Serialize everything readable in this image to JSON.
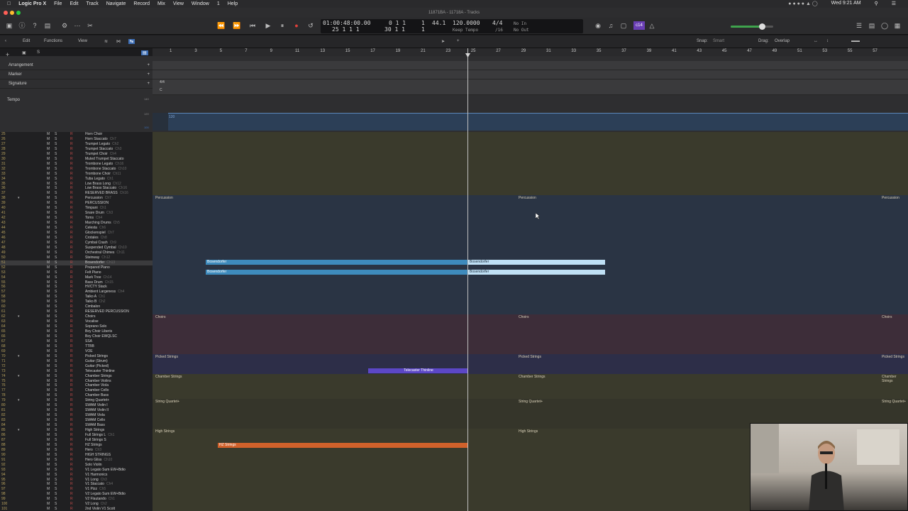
{
  "menubar": {
    "app": "Logic Pro X",
    "items": [
      "File",
      "Edit",
      "Track",
      "Navigate",
      "Record",
      "Mix",
      "View",
      "Window",
      "1",
      "Help"
    ],
    "clock": "Wed 9:21 AM"
  },
  "window": {
    "title": "11871BA - 11718A - Tracks"
  },
  "lcd": {
    "time": "01:00:48:00.00",
    "bars": "25  1  1    1",
    "end_a": "0  1  1",
    "end_b": "30  1  1",
    "end_a_sub": "1",
    "end_b_sub": "1",
    "sample": "44.1",
    "tempo": "120.0000",
    "tempo_label": "Keep Tempo",
    "sig": "4/4",
    "div": "/16",
    "in": "No In",
    "out": "No Out",
    "cpu": "c14"
  },
  "localbar": {
    "edit": "Edit",
    "functions": "Functions",
    "view": "View",
    "snap_label": "Snap:",
    "snap_value": "Smart",
    "drag_label": "Drag:",
    "drag_value": "Overlap"
  },
  "ruler": [
    "1",
    "3",
    "5",
    "7",
    "9",
    "11",
    "13",
    "15",
    "17",
    "19",
    "21",
    "23",
    "25",
    "27",
    "29",
    "31",
    "33",
    "35",
    "37",
    "39",
    "41",
    "43",
    "45",
    "47",
    "49",
    "51",
    "53",
    "55",
    "57"
  ],
  "global_tracks": {
    "arrangement": "Arrangement",
    "marker": "Marker",
    "signature": "Signature",
    "tempo": "Tempo",
    "sig_value": "4/4",
    "key_value": "C",
    "tempo_value": "120",
    "tempo_scale_hi": "140",
    "tempo_scale_mid": "120",
    "tempo_scale_lo": "100"
  },
  "tracks": [
    {
      "n": "25",
      "name": "Horn Choir",
      "ch": ""
    },
    {
      "n": "26",
      "name": "Horn Staccato",
      "ch": "Ch7"
    },
    {
      "n": "27",
      "name": "Trumpet Legato",
      "ch": "Ch2"
    },
    {
      "n": "28",
      "name": "Trumpet Staccato",
      "ch": "Ch3"
    },
    {
      "n": "29",
      "name": "Trumpet Choir",
      "ch": "Ch4"
    },
    {
      "n": "30",
      "name": "Muted Trumpet Staccato",
      "ch": ""
    },
    {
      "n": "31",
      "name": "Trombone Legato",
      "ch": "Ch16"
    },
    {
      "n": "32",
      "name": "Trombone Staccato",
      "ch": "Ch10"
    },
    {
      "n": "33",
      "name": "Trombone Choir",
      "ch": "Ch11"
    },
    {
      "n": "34",
      "name": "Tuba Legato",
      "ch": "Ch1"
    },
    {
      "n": "35",
      "name": "Low Brass Long",
      "ch": "Ch12"
    },
    {
      "n": "36",
      "name": "Low Brass Staccato",
      "ch": "Ch16"
    },
    {
      "n": "37",
      "name": "RESERVED BRASS",
      "ch": "Ch16"
    },
    {
      "n": "38",
      "name": "Percussion",
      "ch": "Ch7"
    },
    {
      "n": "39",
      "name": "PERCUSSION",
      "ch": ""
    },
    {
      "n": "40",
      "name": "Timpani",
      "ch": "Ch1"
    },
    {
      "n": "41",
      "name": "Snare Drum",
      "ch": "Ch3"
    },
    {
      "n": "42",
      "name": "Toms",
      "ch": "Ch4"
    },
    {
      "n": "43",
      "name": "Marching Drums",
      "ch": "Ch5"
    },
    {
      "n": "44",
      "name": "Celesta",
      "ch": "Ch6"
    },
    {
      "n": "45",
      "name": "Glockenspiel",
      "ch": "Ch7"
    },
    {
      "n": "46",
      "name": "Crotales",
      "ch": "Ch8"
    },
    {
      "n": "47",
      "name": "Cymbal Crash",
      "ch": "Ch9"
    },
    {
      "n": "48",
      "name": "Suspended Cymbal",
      "ch": "Ch10"
    },
    {
      "n": "49",
      "name": "Orchestral Chimes",
      "ch": "Ch11"
    },
    {
      "n": "50",
      "name": "Steinway",
      "ch": "Ch12"
    },
    {
      "n": "51",
      "name": "Bosendorfer",
      "ch": "Ch13"
    },
    {
      "n": "52",
      "name": "Prepared Piano",
      "ch": ""
    },
    {
      "n": "53",
      "name": "Felt Piano",
      "ch": ""
    },
    {
      "n": "54",
      "name": "Mark Tree",
      "ch": "Ch14"
    },
    {
      "n": "55",
      "name": "Bass Drum",
      "ch": "Ch15"
    },
    {
      "n": "56",
      "name": "HVCTY Stack",
      "ch": ""
    },
    {
      "n": "57",
      "name": "Ambient Largeness",
      "ch": "Ch4"
    },
    {
      "n": "58",
      "name": "Taiko A",
      "ch": "Ch1"
    },
    {
      "n": "59",
      "name": "Taiko B",
      "ch": "Ch2"
    },
    {
      "n": "60",
      "name": "Cimbalon",
      "ch": ""
    },
    {
      "n": "61",
      "name": "RESERVED PERCUSSION",
      "ch": ""
    },
    {
      "n": "62",
      "name": "Choirs",
      "ch": ""
    },
    {
      "n": "63",
      "name": "Vocalise",
      "ch": ""
    },
    {
      "n": "64",
      "name": "Soprano Solo",
      "ch": ""
    },
    {
      "n": "65",
      "name": "Boy Choir Liberis",
      "ch": ""
    },
    {
      "n": "66",
      "name": "Boy Choir EWQLSC",
      "ch": ""
    },
    {
      "n": "67",
      "name": "SSA",
      "ch": ""
    },
    {
      "n": "68",
      "name": "TTBB",
      "ch": ""
    },
    {
      "n": "69",
      "name": "VOE",
      "ch": ""
    },
    {
      "n": "70",
      "name": "Picked Strings",
      "ch": ""
    },
    {
      "n": "71",
      "name": "Guitar (Strum)",
      "ch": ""
    },
    {
      "n": "72",
      "name": "Guitar (Picked)",
      "ch": ""
    },
    {
      "n": "73",
      "name": "Telecaster Thinline",
      "ch": ""
    },
    {
      "n": "74",
      "name": "Chamber Strings",
      "ch": ""
    },
    {
      "n": "75",
      "name": "Chamber Violins",
      "ch": ""
    },
    {
      "n": "76",
      "name": "Chamber Viola",
      "ch": ""
    },
    {
      "n": "77",
      "name": "Chamber Cello",
      "ch": ""
    },
    {
      "n": "78",
      "name": "Chamber Bass",
      "ch": ""
    },
    {
      "n": "79",
      "name": "String Quartet+",
      "ch": ""
    },
    {
      "n": "80",
      "name": "SWAM Violin I",
      "ch": ""
    },
    {
      "n": "81",
      "name": "SWAM Violin II",
      "ch": ""
    },
    {
      "n": "82",
      "name": "SWAM Viola",
      "ch": ""
    },
    {
      "n": "83",
      "name": "SWAM Cello",
      "ch": ""
    },
    {
      "n": "84",
      "name": "SWAM Bass",
      "ch": ""
    },
    {
      "n": "85",
      "name": "High Strings",
      "ch": ""
    },
    {
      "n": "86",
      "name": "Full Strings L",
      "ch": "Ch1"
    },
    {
      "n": "87",
      "name": "Full Strings S",
      "ch": ""
    },
    {
      "n": "88",
      "name": "HZ Strings",
      "ch": ""
    },
    {
      "n": "89",
      "name": "Hero",
      "ch": "Ch3"
    },
    {
      "n": "90",
      "name": "HIGH STRINGS",
      "ch": ""
    },
    {
      "n": "91",
      "name": "Hero Gliss",
      "ch": "Ch10"
    },
    {
      "n": "92",
      "name": "Solo Violin",
      "ch": ""
    },
    {
      "n": "93",
      "name": "V1 Legato Sum EW+Bdio",
      "ch": ""
    },
    {
      "n": "94",
      "name": "V1 Harmonics",
      "ch": ""
    },
    {
      "n": "95",
      "name": "V1 Long",
      "ch": "Ch3"
    },
    {
      "n": "96",
      "name": "V1 Staccato",
      "ch": "Ch4"
    },
    {
      "n": "97",
      "name": "V1 Pizz",
      "ch": "Ch5"
    },
    {
      "n": "98",
      "name": "V2 Legato Sum EW+Bdio",
      "ch": ""
    },
    {
      "n": "99",
      "name": "V2 Flautando",
      "ch": "Ch1"
    },
    {
      "n": "100",
      "name": "V2 Long",
      "ch": "Ch2"
    },
    {
      "n": "101",
      "name": "2nd Violin V1 Scott",
      "ch": ""
    }
  ],
  "folders": {
    "percussion": "Percussion",
    "choirs": "Choirs",
    "picked": "Picked Strings",
    "chamber": "Chamber Strings",
    "quartet": "String Quartet+",
    "high": "High Strings"
  },
  "regions": {
    "bos1": "Bosendorfer",
    "bos2": "Bosendorfer",
    "bos3": "Bosendorfer",
    "bos4": "Bosendorfer",
    "tele": "Telecaster Thinline",
    "hz": "HZ Strings"
  },
  "colors": {
    "brass_bg": "#3a3a2c",
    "perc_bg": "#2a3444",
    "choir_bg": "#3d2d39",
    "picked_bg": "#2d2e48",
    "chamber_bg": "#3a3a2c",
    "high_bg": "#3a3a2c",
    "region_blue": "#3e8bbd",
    "region_purple": "#5c47c6",
    "region_orange": "#d0612b"
  }
}
